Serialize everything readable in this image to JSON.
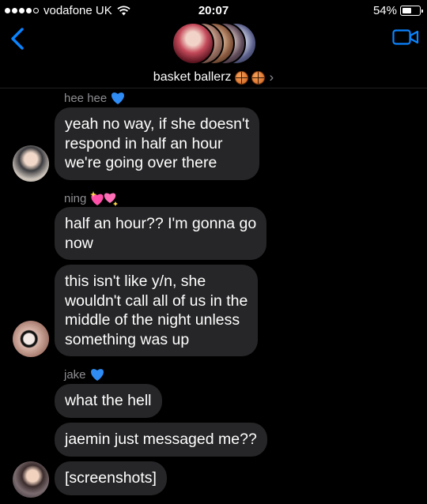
{
  "status_bar": {
    "carrier": "vodafone UK",
    "time": "20:07",
    "battery": "54%",
    "battery_level": 0.54,
    "signal_dots": 5,
    "signal_filled": 4
  },
  "header": {
    "group_name": "basket ballerz",
    "back_icon": "chevron-left-icon",
    "video_icon": "video-camera-icon",
    "accent": "#0a84ff"
  },
  "messages": [
    {
      "sender": "hee hee",
      "sender_icon": "blue-heart",
      "text": [
        "yeah no way, if she doesn't",
        "respond in half an hour",
        "we're going over there"
      ]
    },
    {
      "sender": "ning",
      "sender_icon": "sparkling-hearts",
      "text": [
        "half an hour?? I'm gonna go",
        "now"
      ]
    },
    {
      "text": [
        "this isn't like y/n, she",
        "wouldn't call all of us in the",
        "middle of the night unless",
        "something was up"
      ]
    },
    {
      "sender": "jake",
      "sender_icon": "blue-heart",
      "text": [
        "what the hell"
      ]
    },
    {
      "text": [
        "jaemin just messaged me??"
      ]
    },
    {
      "text": [
        "[screenshots]"
      ]
    }
  ],
  "colors": {
    "background": "#000000",
    "bubble": "#262628",
    "sender_text": "#8e8e93"
  }
}
